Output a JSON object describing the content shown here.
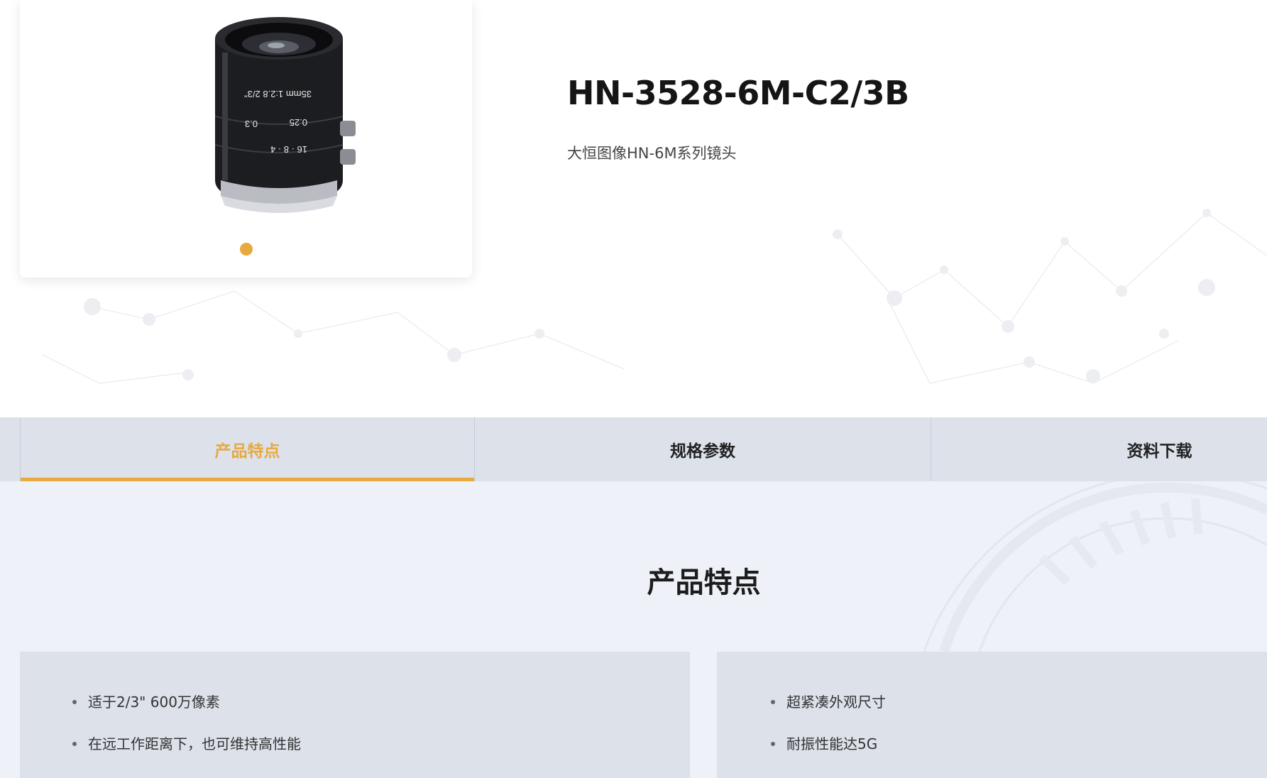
{
  "product": {
    "title": "HN-3528-6M-C2/3B",
    "subtitle": "大恒图像HN-6M系列镜头",
    "image_icon": "camera-lens-image",
    "lens_markings": {
      "focal": "35mm 1:2.8 2/3\"",
      "distances": [
        "0.25",
        "0.3"
      ],
      "apertures": [
        "16",
        "8",
        "4"
      ]
    },
    "carousel": {
      "count": 1,
      "active": 0
    }
  },
  "tabs": [
    {
      "label": "产品特点",
      "active": true
    },
    {
      "label": "规格参数",
      "active": false
    },
    {
      "label": "资料下载",
      "active": false
    }
  ],
  "features": {
    "heading": "产品特点",
    "left": [
      "适于2/3\" 600万像素",
      "在远工作距离下，也可维持高性能"
    ],
    "right": [
      "超紧凑外观尺寸",
      "耐振性能达5G"
    ]
  },
  "colors": {
    "accent": "#e8a93e",
    "tab_bg": "#dce1ea",
    "section_bg": "#eef1f7",
    "top_line": "#3d4a5c"
  }
}
